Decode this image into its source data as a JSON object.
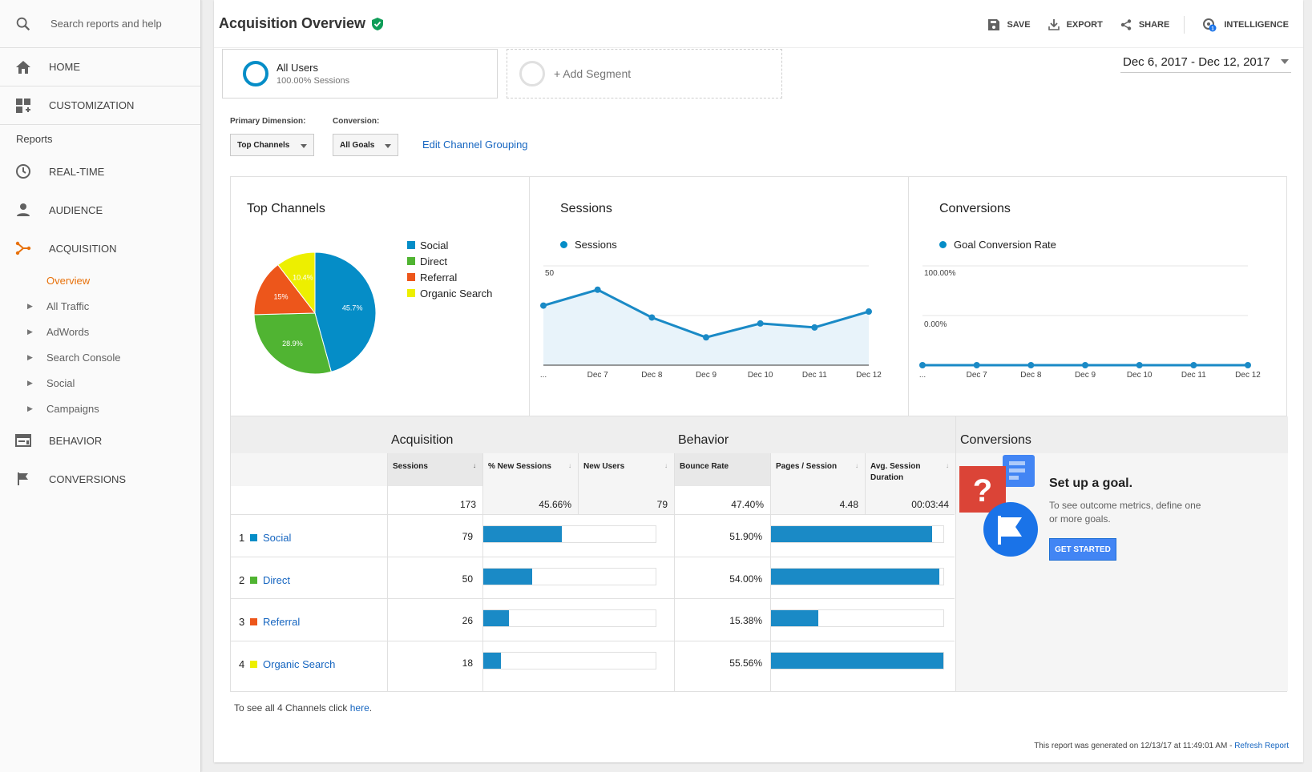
{
  "sidebar": {
    "search_placeholder": "Search reports and help",
    "home": "HOME",
    "customization": "CUSTOMIZATION",
    "reports_heading": "Reports",
    "realtime": "REAL-TIME",
    "audience": "AUDIENCE",
    "acquisition": "ACQUISITION",
    "acq_items": [
      "Overview",
      "All Traffic",
      "AdWords",
      "Search Console",
      "Social",
      "Campaigns"
    ],
    "behavior": "BEHAVIOR",
    "conversions": "CONVERSIONS",
    "accent": "#e8710a"
  },
  "header": {
    "title": "Acquisition Overview",
    "save": "SAVE",
    "export": "EXPORT",
    "share": "SHARE",
    "intelligence": "INTELLIGENCE",
    "intelligence_badge": "1"
  },
  "segments": {
    "seg1_name": "All Users",
    "seg1_sub": "100.00% Sessions",
    "add": "+ Add Segment"
  },
  "date_range": "Dec 6, 2017 - Dec 12, 2017",
  "controls": {
    "primary_label": "Primary Dimension:",
    "primary_value": "Top Channels",
    "conversion_label": "Conversion:",
    "conversion_value": "All Goals",
    "edit_link": "Edit Channel Grouping"
  },
  "colors": {
    "social": "#058dc7",
    "direct": "#50b432",
    "referral": "#ed561b",
    "organic": "#edef00",
    "bar": "#1a8ac6",
    "link": "#1565c0"
  },
  "chart_data": [
    {
      "type": "pie",
      "title": "Top Channels",
      "categories": [
        "Social",
        "Direct",
        "Referral",
        "Organic Search"
      ],
      "values": [
        45.7,
        28.9,
        15,
        10.4
      ],
      "labels": [
        "45.7%",
        "28.9%",
        "15%",
        "10.4%"
      ],
      "legend": "right"
    },
    {
      "type": "area",
      "title": "Sessions",
      "series": [
        {
          "name": "Sessions",
          "values": [
            30,
            38,
            24,
            14,
            21,
            19,
            27
          ]
        }
      ],
      "x": [
        "...",
        "Dec 7",
        "Dec 8",
        "Dec 9",
        "Dec 10",
        "Dec 11",
        "Dec 12"
      ],
      "ytick_labels": [
        "50",
        "25"
      ],
      "ylim": [
        0,
        50
      ]
    },
    {
      "type": "line",
      "title": "Conversions",
      "series": [
        {
          "name": "Goal Conversion Rate",
          "values": [
            0,
            0,
            0,
            0,
            0,
            0,
            0
          ]
        }
      ],
      "x": [
        "...",
        "Dec 7",
        "Dec 8",
        "Dec 9",
        "Dec 10",
        "Dec 11",
        "Dec 12"
      ],
      "ytick_labels": [
        "100.00%",
        "0.00%"
      ],
      "ylim": [
        0,
        100
      ]
    }
  ],
  "table": {
    "group_acq": "Acquisition",
    "group_beh": "Behavior",
    "group_conv": "Conversions",
    "cols": [
      "Sessions",
      "% New Sessions",
      "New Users",
      "Bounce Rate",
      "Pages / Session",
      "Avg. Session Duration"
    ],
    "totals": [
      "173",
      "45.66%",
      "79",
      "47.40%",
      "4.48",
      "00:03:44"
    ],
    "rows": [
      {
        "rank": "1",
        "name": "Social",
        "sessions": "79",
        "sessions_frac": 0.455,
        "bounce": "51.90%",
        "bounce_frac": 0.935
      },
      {
        "rank": "2",
        "name": "Direct",
        "sessions": "50",
        "sessions_frac": 0.285,
        "bounce": "54.00%",
        "bounce_frac": 0.975
      },
      {
        "rank": "3",
        "name": "Referral",
        "sessions": "26",
        "sessions_frac": 0.148,
        "bounce": "15.38%",
        "bounce_frac": 0.275
      },
      {
        "rank": "4",
        "name": "Organic Search",
        "sessions": "18",
        "sessions_frac": 0.1,
        "bounce": "55.56%",
        "bounce_frac": 1.0
      }
    ]
  },
  "goal": {
    "title": "Set up a goal.",
    "desc": "To see outcome metrics, define one or more goals.",
    "button": "GET STARTED"
  },
  "footer": {
    "see_all": "To see all 4 Channels click ",
    "here": "here",
    "period": ".",
    "generated": "This report was generated on 12/13/17 at 11:49:01 AM - ",
    "refresh": "Refresh Report"
  }
}
